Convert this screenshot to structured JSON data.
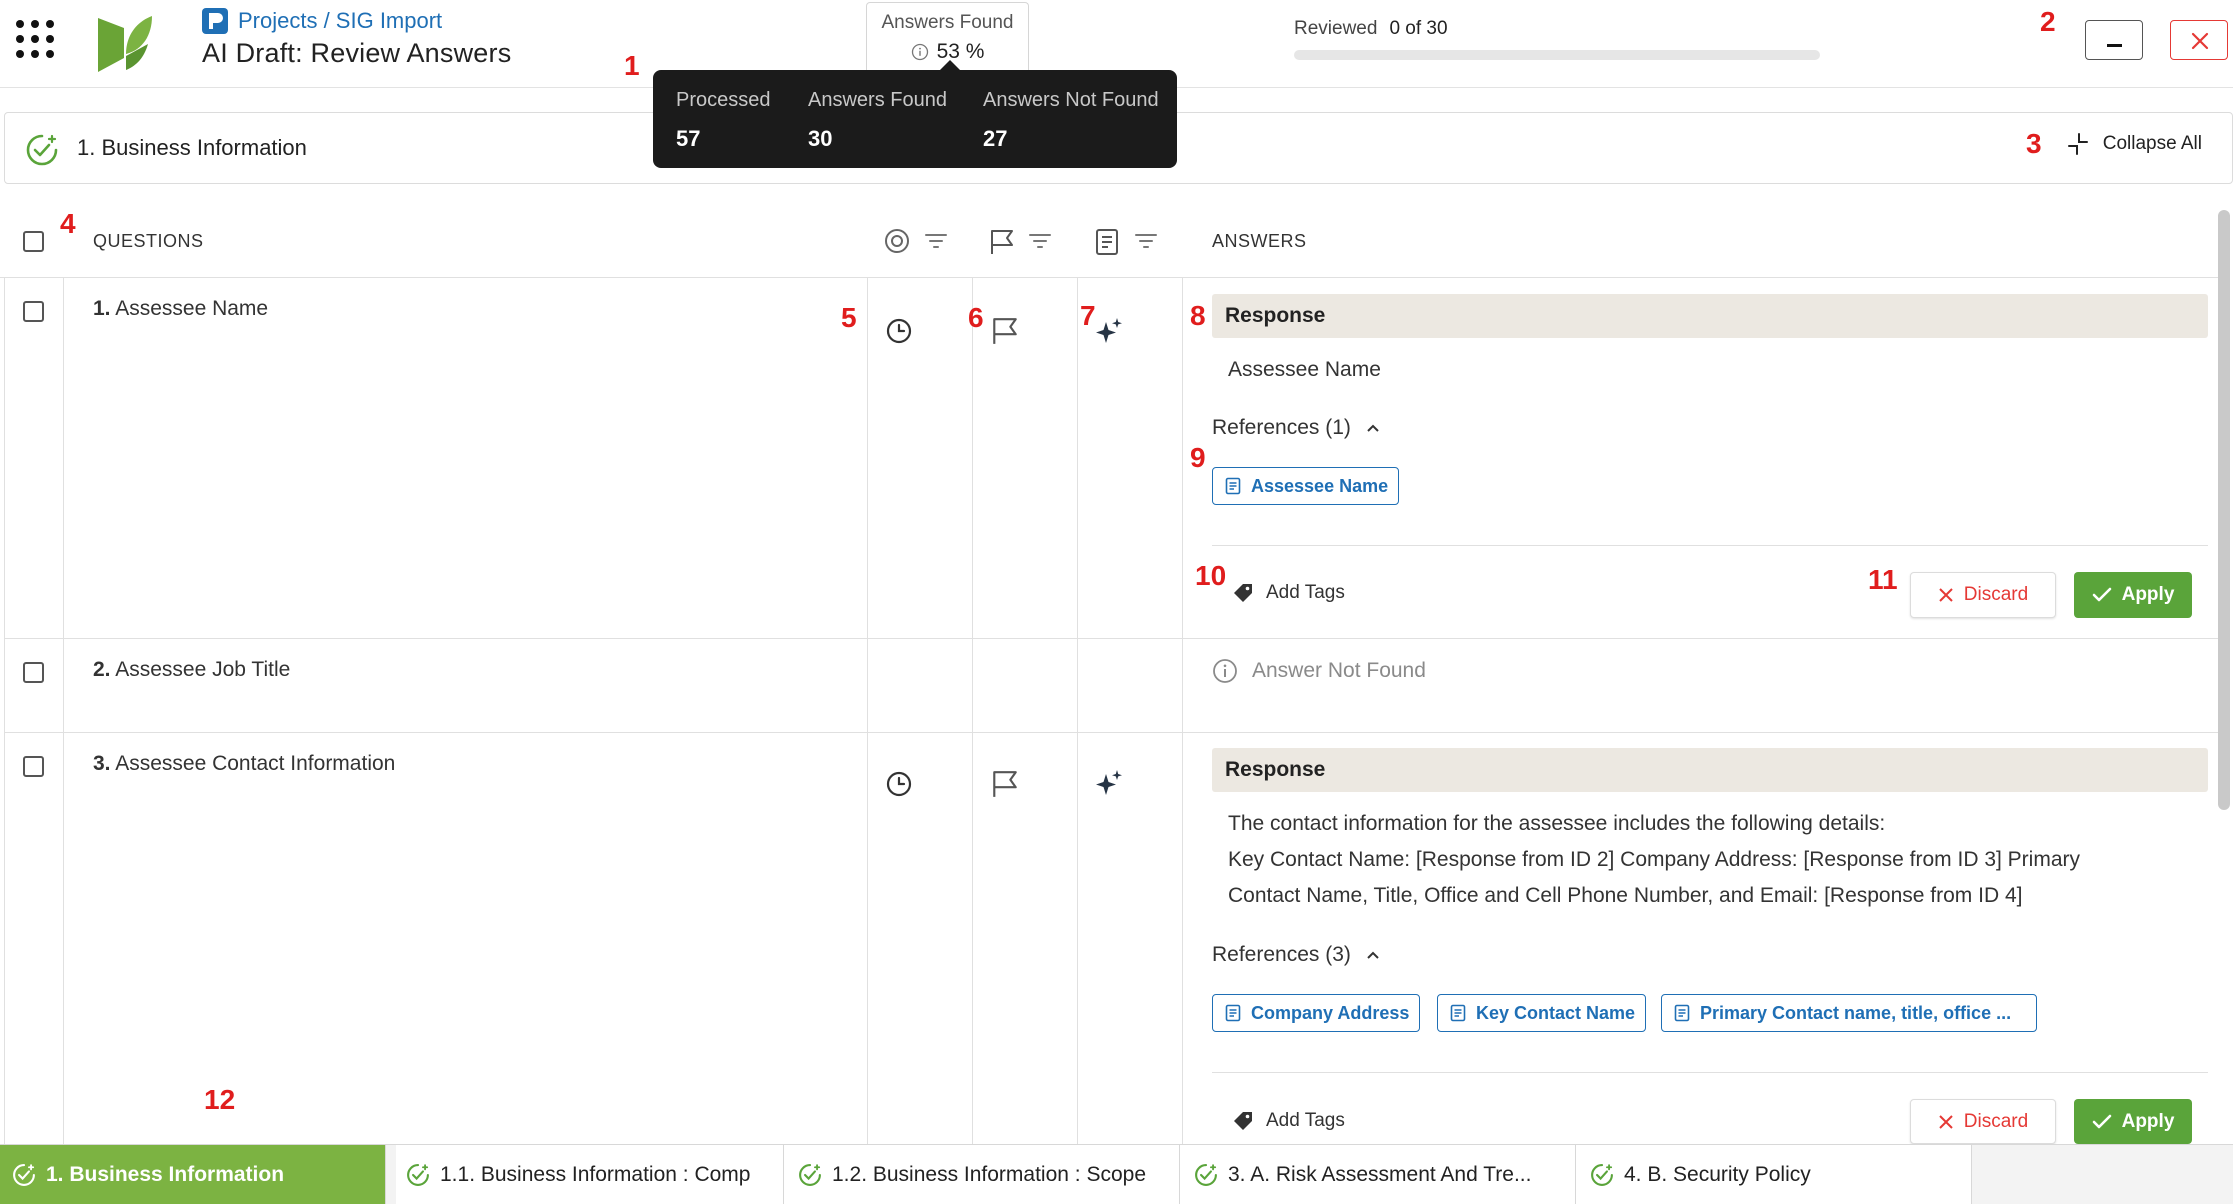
{
  "header": {
    "breadcrumb": "Projects / SIG Import",
    "title": "AI Draft: Review Answers",
    "answers_found_label": "Answers Found",
    "answers_found_pct": "53 %",
    "reviewed_label": "Reviewed",
    "reviewed_value": "0 of 30",
    "reviewed_progress": 0
  },
  "tooltip": {
    "processed_label": "Processed",
    "processed_value": "57",
    "found_label": "Answers Found",
    "found_value": "30",
    "not_found_label": "Answers Not Found",
    "not_found_value": "27"
  },
  "section": {
    "title": "1. Business Information",
    "collapse_label": "Collapse All"
  },
  "table": {
    "questions_header": "QUESTIONS",
    "answers_header": "ANSWERS",
    "rows": [
      {
        "num": "1.",
        "question": "Assessee Name",
        "response_label": "Response",
        "response": "Assessee Name",
        "references_label": "References (1)",
        "references": [
          "Assessee Name"
        ],
        "add_tags": "Add Tags",
        "discard": "Discard",
        "apply": "Apply"
      },
      {
        "num": "2.",
        "question": "Assessee Job Title",
        "not_found": "Answer Not Found"
      },
      {
        "num": "3.",
        "question": "Assessee Contact Information",
        "response_label": "Response",
        "response_lines": [
          "The contact information for the assessee includes the following details:",
          "Key Contact Name: [Response from ID 2] Company Address: [Response from ID 3] Primary",
          "Contact Name, Title, Office and Cell Phone Number, and Email: [Response from ID 4]"
        ],
        "references_label": "References (3)",
        "references": [
          "Company Address",
          "Key Contact Name",
          "Primary Contact name, title, office ..."
        ],
        "add_tags": "Add Tags",
        "discard": "Discard",
        "apply": "Apply"
      }
    ]
  },
  "markers": [
    "1",
    "2",
    "3",
    "4",
    "5",
    "6",
    "7",
    "8",
    "9",
    "10",
    "11",
    "12"
  ],
  "tabs": [
    {
      "label": "1. Business Information",
      "active": true
    },
    {
      "label": "1.1. Business Information : Comp",
      "active": false
    },
    {
      "label": "1.2. Business Information : Scope",
      "active": false
    },
    {
      "label": "3. A. Risk Assessment And Tre...",
      "active": false
    },
    {
      "label": "4. B. Security Policy",
      "active": false
    }
  ],
  "colors": {
    "brand_green": "#7cb342",
    "apply_green": "#5aa43a",
    "link_blue": "#1f6fb5",
    "discard_red": "#e53935",
    "marker_red": "#e01d1d",
    "response_bg": "#ece8e1",
    "tooltip_bg": "#1b1b1b"
  },
  "icons": {
    "apps": "apps-grid-icon",
    "logo": "leaf-logo-icon",
    "status": "clock-icon",
    "flag": "flag-icon",
    "ai": "sparkle-icon",
    "reference": "document-icon",
    "tag": "tag-icon",
    "info": "info-icon"
  }
}
